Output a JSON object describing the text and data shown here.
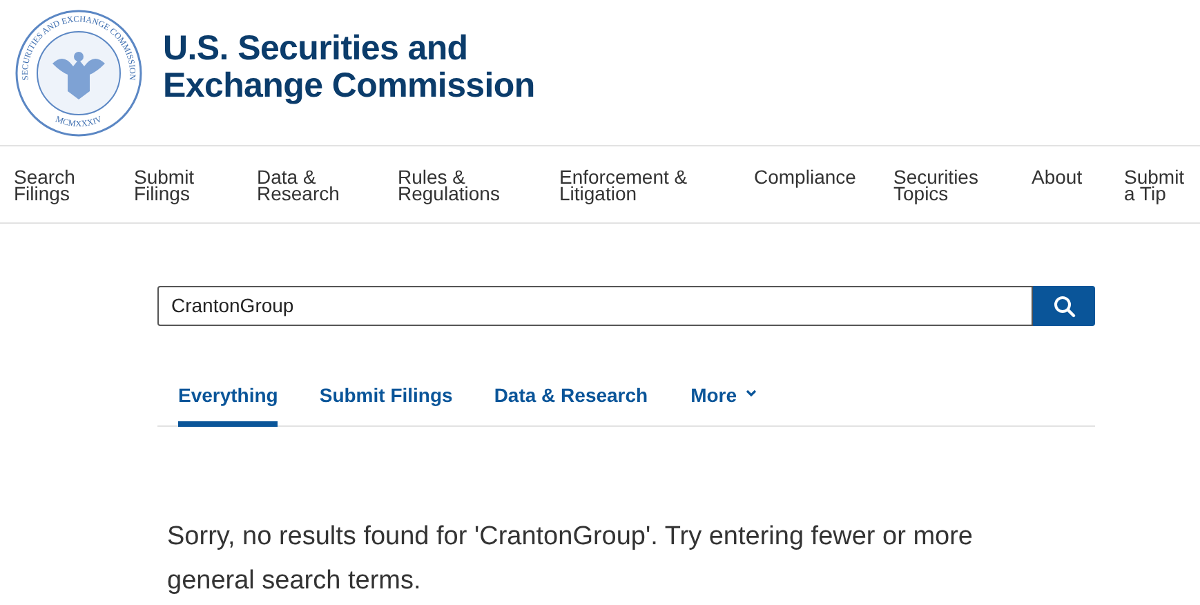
{
  "logo": {
    "seal_top": "SECURITIES AND EXCHANGE COMMISSION",
    "seal_bottom": "MCMXXXIV",
    "title_lines": [
      "U.S. Securities and",
      "Exchange Commission"
    ]
  },
  "nav": [
    {
      "lines": [
        "Search",
        "Filings"
      ]
    },
    {
      "lines": [
        "Submit",
        "Filings"
      ]
    },
    {
      "lines": [
        "Data &",
        "Research"
      ]
    },
    {
      "lines": [
        "Rules &",
        "Regulations"
      ]
    },
    {
      "lines": [
        "Enforcement &",
        "Litigation"
      ]
    },
    {
      "lines": [
        "Compliance"
      ]
    },
    {
      "lines": [
        "Securities",
        "Topics"
      ]
    },
    {
      "lines": [
        "About"
      ]
    },
    {
      "lines": [
        "Submit",
        "a Tip"
      ]
    }
  ],
  "search": {
    "value": "CrantonGroup"
  },
  "tabs": [
    {
      "label": "Everything",
      "selected": true,
      "kind": "tab"
    },
    {
      "label": "Submit Filings",
      "selected": false,
      "kind": "tab"
    },
    {
      "label": "Data & Research",
      "selected": false,
      "kind": "tab"
    },
    {
      "label": "More",
      "selected": false,
      "kind": "dropdown"
    }
  ],
  "message": "Sorry, no results found for 'CrantonGroup'. Try entering fewer or more general search terms."
}
